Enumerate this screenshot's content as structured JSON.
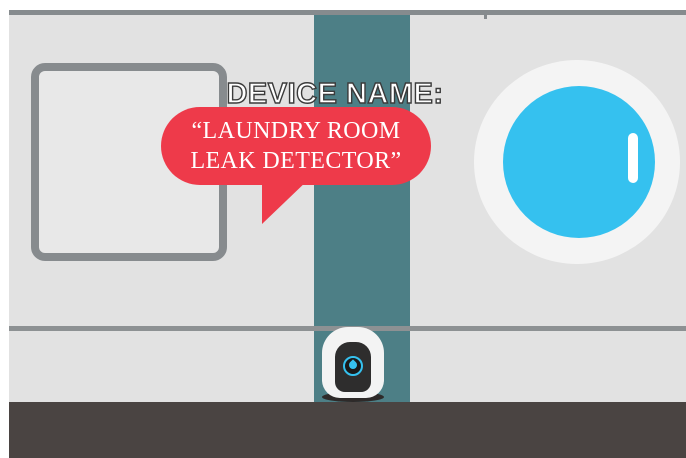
{
  "scene": {
    "title": "DEVICE NAME:",
    "speech_bubble": {
      "line1": "“LAUNDRY ROOM",
      "line2": "LEAK DETECTOR”"
    }
  },
  "colors": {
    "wall": "#e2e2e2",
    "pipe": "#4d7f86",
    "floor": "#4a4442",
    "washer_door": "#35c1ef",
    "bubble": "#ee3a4a",
    "sensor_accent": "#35c1ef"
  },
  "icons": {
    "sensor": "water-drop-icon"
  }
}
